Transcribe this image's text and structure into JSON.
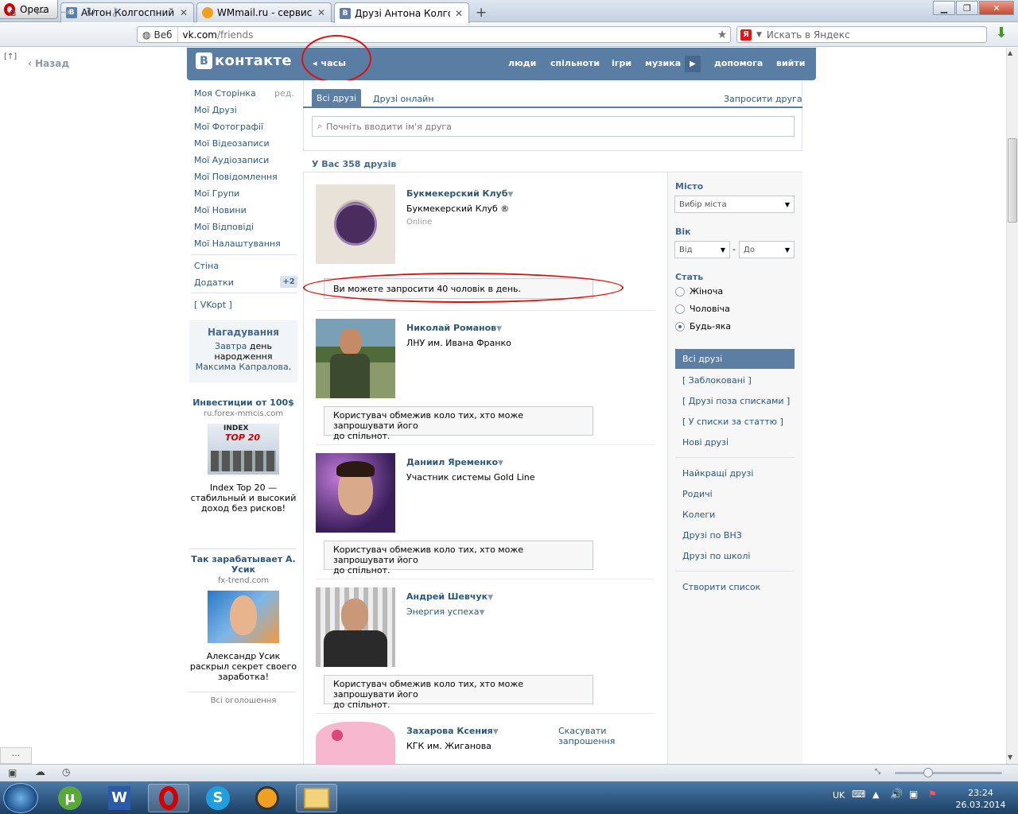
{
  "browser": {
    "opera_label": "Opera",
    "tabs": [
      {
        "title": "Антон Колгоспний",
        "icon": "vk-icon"
      },
      {
        "title": "WMmail.ru - сервис п...",
        "icon": "wmmail-icon"
      },
      {
        "title": "Друзі Антона Колгоспн...",
        "icon": "vk-icon"
      }
    ],
    "web_label": "Веб",
    "url_host": "vk.com",
    "url_path": "/friends",
    "search_placeholder": "Искать в Яндекс",
    "back_label": "Назад",
    "back_top_label": "[↑]"
  },
  "vk": {
    "logo_text": "контакте",
    "logo_letter": "В",
    "hours_label": "часы",
    "nav": [
      "люди",
      "спільноти",
      "ігри",
      "музика",
      "допомога",
      "вийти"
    ]
  },
  "left_menu": {
    "items": [
      "Моя Сторінка",
      "Мої Друзі",
      "Мої Фотографії",
      "Мої Відеозаписи",
      "Мої Аудіозаписи",
      "Мої Повідомлення",
      "Мої Групи",
      "Мої Новини",
      "Мої Відповіді",
      "Мої Налаштування"
    ],
    "edit_label": "ред.",
    "wall": "Стіна",
    "apps": "Додатки",
    "apps_badge": "+2",
    "vkopt": "[ VKopt ]",
    "reminder": {
      "title": "Нагадування",
      "line1_link": "Завтра",
      "line1_rest": " день",
      "line2": "народження",
      "line3_link": "Максима Капралова",
      "line3_end": "."
    },
    "ads": [
      {
        "title": "Инвестиции от 100$",
        "site": "ru.forex-mmcis.com",
        "text": "Index Top 20 — стабильный и высокий доход без рисков!",
        "img_text1": "INDEX",
        "img_text2": "TOP 20"
      },
      {
        "title": "Так зарабатывает А. Усик",
        "site": "fx-trend.com",
        "text": "Александр Усик раскрыл секрет своего заработка!"
      }
    ],
    "all_ads": "Всі оголошення"
  },
  "friends": {
    "tab_all": "Всі друзі",
    "tab_online": "Друзі онлайн",
    "invite_link": "Запросити друга",
    "search_placeholder": "Почніть вводити ім'я друга",
    "summary": "У Вас 358 друзів",
    "list": [
      {
        "name": "Букмекерский Клуб",
        "sub": "Букмекерский Клуб ®",
        "status": "Online",
        "notice": "Ви можете запросити 40 чоловік в день."
      },
      {
        "name": "Николай Романов",
        "sub": "ЛНУ им. Ивана Франко",
        "notice_l1": "Користувач обмежив коло тих, хто може запрошувати його",
        "notice_l2": "до спільнот."
      },
      {
        "name": "Даниил Яременко",
        "sub": "Участник системы Gold Line",
        "notice_l1": "Користувач обмежив коло тих, хто може запрошувати його",
        "notice_l2": "до спільнот."
      },
      {
        "name": "Андрей Шевчук",
        "sub": "Энергия успеха",
        "notice_l1": "Користувач обмежив коло тих, хто може запрошувати його",
        "notice_l2": "до спільнот."
      },
      {
        "name": "Захарова Ксения",
        "sub": "КГК им. Жиганова",
        "action_l1": "Скасувати",
        "action_l2": "запрошення"
      }
    ]
  },
  "filters": {
    "city_label": "Місто",
    "city_select": "Вибір міста",
    "age_label": "Вік",
    "age_from": "Від",
    "age_dash": "-",
    "age_to": "До",
    "sex_label": "Стать",
    "sex_options": [
      "Жіноча",
      "Чоловіча",
      "Будь-яка"
    ],
    "sex_selected": "Будь-яка",
    "lists": [
      "Всі друзі",
      "[ Заблоковані ]",
      "[ Друзі поза списками ]",
      "[ У списки за статтю ]",
      "Нові друзі",
      "Найкращі друзі",
      "Родичі",
      "Колеги",
      "Друзі по ВНЗ",
      "Друзі по школі",
      "Створити список"
    ]
  },
  "taskbar": {
    "lang": "UK",
    "time": "23:24",
    "date": "26.03.2014",
    "status_dots": "..."
  },
  "colors": {
    "vk_blue": "#597da3",
    "link": "#2b587a",
    "annotation_red": "#e01010"
  }
}
